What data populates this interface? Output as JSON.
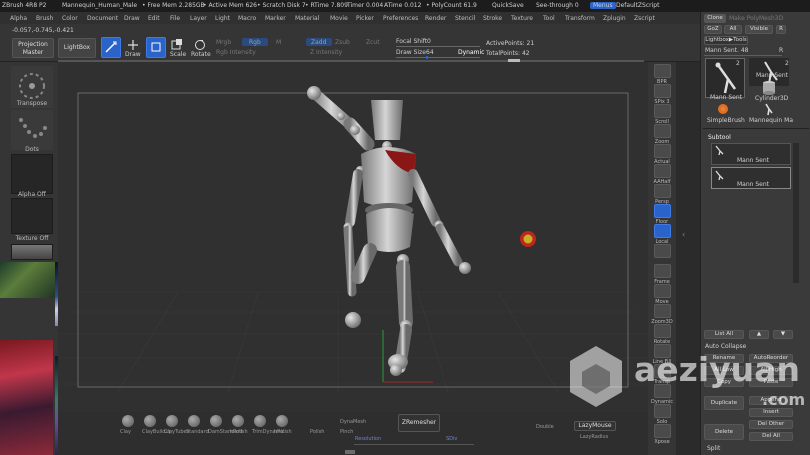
{
  "titlebar": {
    "app": "ZBrush 4R8 P2",
    "file": "Mannequin_Human_Male",
    "free_mem": "• Free Mem 2.285GB",
    "active_mem": "• Active Mem 626",
    "scratch": "• Scratch Disk 7",
    "rtime": "• RTime 7.809",
    "timer": "Timer 0.004",
    "atime": "ATime 0.012",
    "polycount": "• PolyCount 61.9",
    "quicksave": "QuickSave",
    "see_through": "See-through  0",
    "menus_btn": "Menus",
    "default_script": "DefaultZScript"
  },
  "menubar": [
    "Alpha",
    "Brush",
    "Color",
    "Document",
    "Draw",
    "Edit",
    "File",
    "Layer",
    "Light",
    "Macro",
    "Marker",
    "Material",
    "Movie",
    "Picker",
    "Preferences",
    "Render",
    "Stencil",
    "Stroke",
    "Texture",
    "Tool",
    "Transform",
    "Zplugin",
    "Zscript"
  ],
  "coords": "-0.057,-0.745,-0.421",
  "topshelf": {
    "projection_master": "Projection Master",
    "lightbox": "LightBox",
    "edit": "Edit",
    "draw": "Draw",
    "move": "Move",
    "scale": "Scale",
    "rotate": "Rotate",
    "mrgb": "Mrgb",
    "rgb": "Rgb",
    "m": "M",
    "rgb_intensity": "Rgb Intensity",
    "zadd": "Zadd",
    "zsub": "Zsub",
    "zcut": "Zcut",
    "z_intensity": "Z Intensity",
    "focal_shift": "Focal Shift",
    "focal_shift_val": "0",
    "draw_size": "Draw Size",
    "draw_size_val": "64",
    "dynamic": "Dynamic",
    "active_points": "ActivePoints: 21",
    "total_points": "TotalPoints: 42"
  },
  "leftpanel": {
    "transpose": "Transpose",
    "dots": "Dots",
    "alpha_off": "Alpha Off",
    "texture_off": "Texture Off"
  },
  "rightshelf": [
    "BPR",
    "SPix 3",
    "Scroll",
    "Zoom",
    "Actual",
    "AAHalf",
    "Persp",
    "Floor",
    "Local",
    "",
    "Frame",
    "Move",
    "Zoom3D",
    "Rotate",
    "Line Fill",
    "Transp",
    "Dynamic",
    "Solo",
    "Xpose"
  ],
  "tray": {
    "clone": "Clone",
    "make_polymesh": "Make PolyMesh3D",
    "goz": "GoZ",
    "all": "All",
    "visible": "Visible",
    "r": "R",
    "lightbox_tools": "Lightbox▶Tools",
    "mann_sent_48": "Mann Sent. 48",
    "r2": "R",
    "tool1": "Mann Sent",
    "tool1_count": "2",
    "tool2": "Mann Sent",
    "tool2_count": "2",
    "tool3": "Cylinder3D",
    "tool4": "SimpleBrush",
    "tool5": "Mannequin Ma",
    "subtool": "Subtool",
    "sub1": "Mann Sent",
    "sub2": "Mann Sent",
    "list_all": "List All",
    "auto_collapse": "Auto Collapse",
    "rename": "Rename",
    "auto_reorder": "AutoReorder",
    "all_low": "All Low",
    "all_high": "All High",
    "copy": "Copy",
    "paste": "Paste",
    "duplicate": "Duplicate",
    "append": "Append",
    "insert": "Insert",
    "delete": "Delete",
    "del_other": "Del Other",
    "del_all": "Del All",
    "split": "Split"
  },
  "bottombar": {
    "brushes": [
      "Clay",
      "ClayBuildup",
      "ClayTubes",
      "Standard",
      "DamStandard",
      "hPolish",
      "TrimDynamic",
      "hPolish"
    ],
    "dynamesh": "DynaMesh",
    "zremesher": "ZRemesher",
    "resolution": "Resolution",
    "sdiv": "SDiv",
    "double": "Double",
    "lazymouse": "LazyMouse",
    "lazyradius": "LazyRadius",
    "polish": "Polish",
    "pinch": "Pinch"
  },
  "watermark": {
    "text": "aeziyuan",
    "dotcom": ".com"
  },
  "colors": {
    "accent_blue": "#2a63c9",
    "mannequin": "#b0b0b0",
    "red_patch": "#8a1616",
    "cursor_ring": "#c0261d"
  }
}
